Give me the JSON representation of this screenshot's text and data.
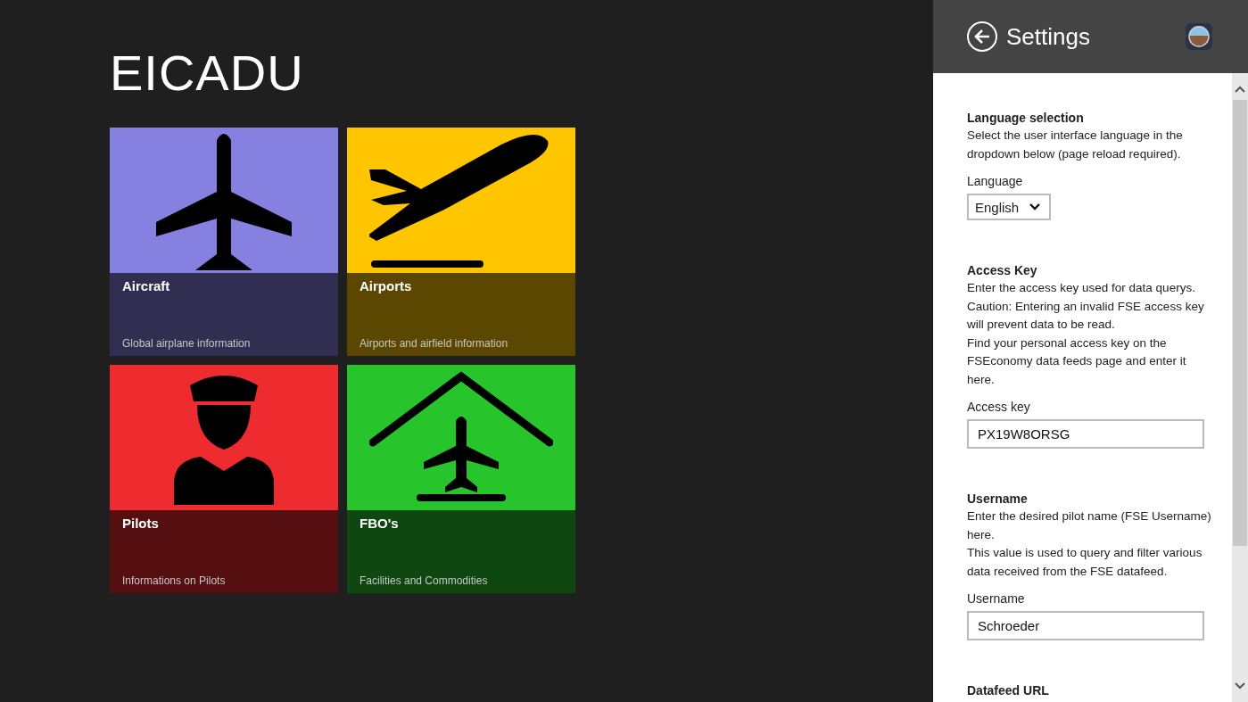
{
  "app_title": "EICADU",
  "tiles": [
    {
      "kind": "aircraft",
      "title": "Aircraft",
      "subtitle": "Global airplane information",
      "color": "#8680e0"
    },
    {
      "kind": "airports",
      "title": "Airports",
      "subtitle": "Airports and airfield information",
      "color": "#ffc600"
    },
    {
      "kind": "pilots",
      "title": "Pilots",
      "subtitle": "Informations on Pilots",
      "color": "#ee2b2e"
    },
    {
      "kind": "fbo",
      "title": "FBO's",
      "subtitle": "Facilities and Commodities",
      "color": "#27c42b"
    }
  ],
  "settings": {
    "title": "Settings",
    "sections": [
      {
        "kind": "dropdown",
        "heading": "Language selection",
        "description": [
          "Select the user interface language in the dropdown below (page reload required)."
        ],
        "label": "Language",
        "value": "English"
      },
      {
        "kind": "text",
        "heading": "Access Key",
        "description": [
          "Enter the access key used for data querys.",
          "Caution: Entering an invalid FSE access key will prevent data to be read.",
          "Find your personal access key on the FSEconomy data feeds page and enter it here."
        ],
        "label": "Access key",
        "value": "PX19W8ORSG"
      },
      {
        "kind": "text",
        "heading": "Username",
        "description": [
          "Enter the desired pilot name (FSE Username) here.",
          "This value is used to query and filter various data received from the FSE datafeed."
        ],
        "label": "Username",
        "value": "Schroeder"
      },
      {
        "kind": "heading",
        "heading": "Datafeed URL"
      }
    ]
  }
}
